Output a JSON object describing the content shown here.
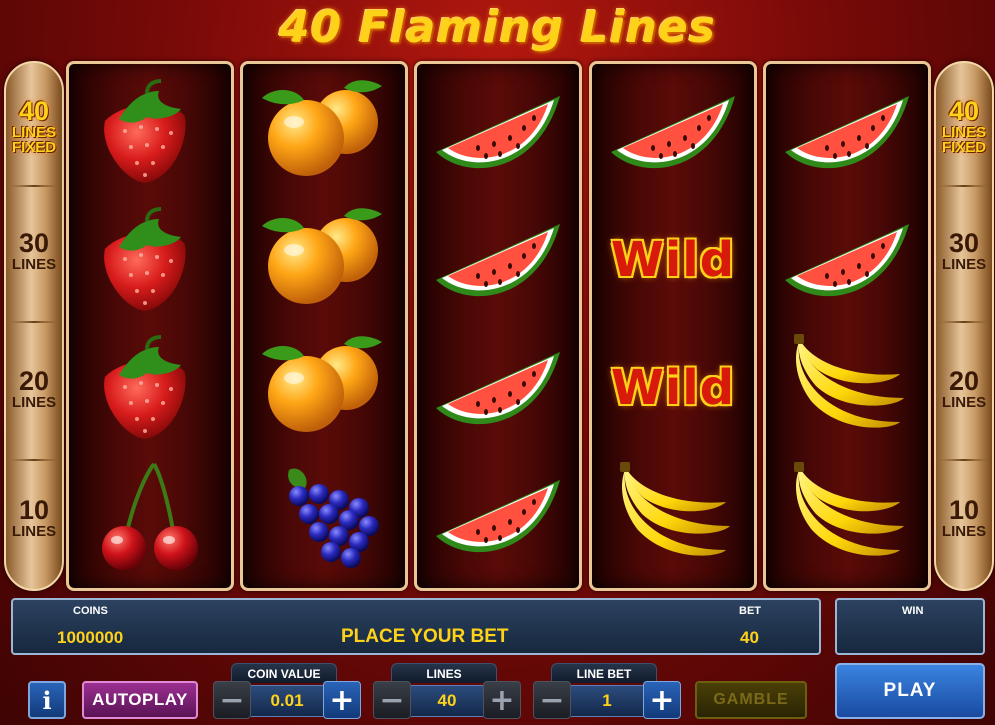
{
  "game": {
    "title": "40 Flaming Lines"
  },
  "side_indicators": [
    {
      "num": "40",
      "label": "LINES",
      "sub": "FIXED",
      "active": true
    },
    {
      "num": "30",
      "label": "LINES",
      "active": false
    },
    {
      "num": "20",
      "label": "LINES",
      "active": false
    },
    {
      "num": "10",
      "label": "LINES",
      "active": false
    }
  ],
  "reels": [
    [
      "strawberry",
      "strawberry",
      "strawberry",
      "cherry"
    ],
    [
      "orange",
      "orange",
      "orange",
      "grapes"
    ],
    [
      "watermelon",
      "watermelon",
      "watermelon",
      "watermelon"
    ],
    [
      "watermelon",
      "wild",
      "wild",
      "banana"
    ],
    [
      "watermelon",
      "watermelon",
      "banana",
      "banana"
    ]
  ],
  "wild_text": "Wild",
  "info": {
    "coins_label": "COINS",
    "coins_value": "1000000",
    "message": "PLACE YOUR BET",
    "bet_label": "BET",
    "bet_value": "40",
    "win_label": "WIN",
    "win_value": ""
  },
  "controls": {
    "info_label": "i",
    "autoplay_label": "AUTOPLAY",
    "coin_value": {
      "label": "COIN VALUE",
      "value": "0.01",
      "minus": "−",
      "plus": "+"
    },
    "lines": {
      "label": "LINES",
      "value": "40",
      "minus": "−",
      "plus": "+"
    },
    "line_bet": {
      "label": "LINE BET",
      "value": "1",
      "minus": "−",
      "plus": "+"
    },
    "gamble_label": "GAMBLE",
    "play_label": "PLAY"
  },
  "colors": {
    "accent_yellow": "#ffd21a",
    "play_blue": "#2a64b8",
    "autoplay_purple": "#9c2f92",
    "reel_frame": "#e9c796"
  }
}
